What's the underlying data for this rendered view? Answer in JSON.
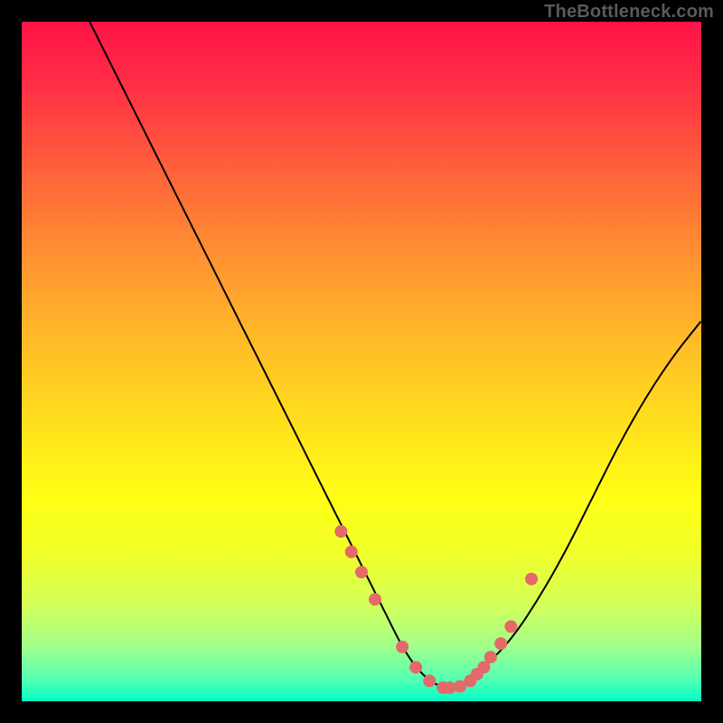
{
  "watermark": "TheBottleneck.com",
  "colors": {
    "page_bg": "#000000",
    "marker": "#e46a6a",
    "curve": "#000000"
  },
  "chart_data": {
    "type": "line",
    "title": "",
    "xlabel": "",
    "ylabel": "",
    "xlim": [
      0,
      100
    ],
    "ylim": [
      0,
      100
    ],
    "grid": false,
    "legend": false,
    "series": [
      {
        "name": "bottleneck-curve",
        "x": [
          10,
          14,
          18,
          22,
          26,
          30,
          34,
          38,
          42,
          46,
          50,
          52,
          54,
          56,
          58,
          60,
          62,
          64,
          66,
          68,
          72,
          76,
          80,
          84,
          88,
          92,
          96,
          100
        ],
        "y": [
          100,
          92,
          84,
          76,
          68,
          60,
          52,
          44,
          36,
          28,
          20,
          16,
          12,
          8,
          5,
          3,
          2,
          2,
          3,
          5,
          9,
          15,
          22,
          30,
          38,
          45,
          51,
          56
        ]
      }
    ],
    "markers": {
      "name": "highlighted-points",
      "x": [
        47,
        48.5,
        50,
        52,
        56,
        58,
        60,
        62,
        63,
        64.5,
        66,
        67,
        68,
        69,
        70.5,
        72,
        75
      ],
      "y": [
        25,
        22,
        19,
        15,
        8,
        5,
        3,
        2,
        2,
        2.2,
        3,
        4,
        5,
        6.5,
        8.5,
        11,
        18
      ]
    }
  }
}
